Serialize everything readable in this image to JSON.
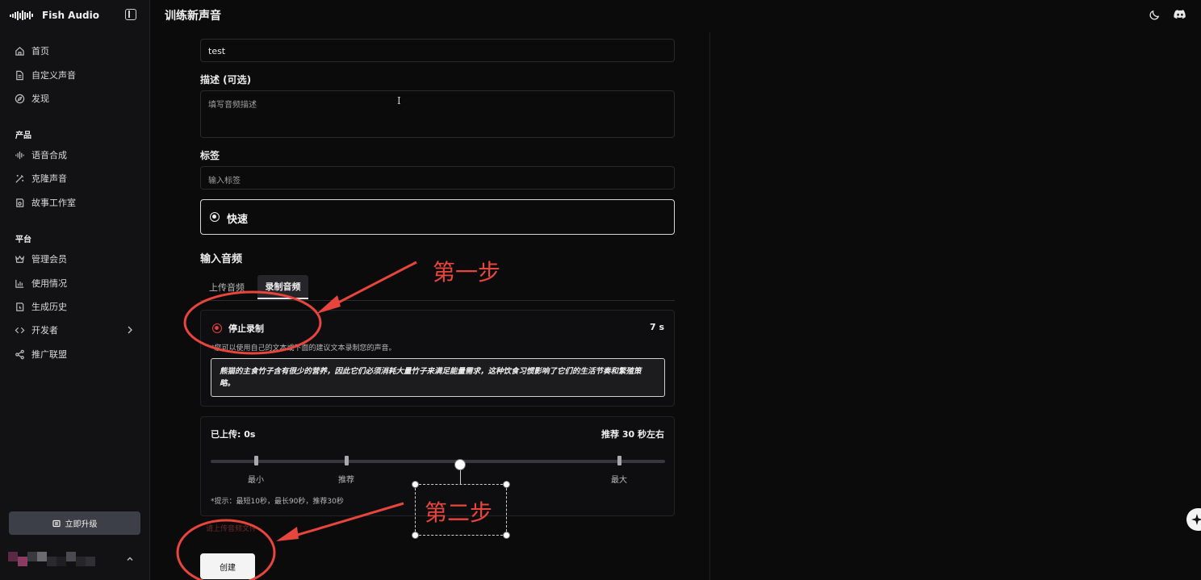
{
  "app": {
    "brand": "Fish Audio",
    "page_title": "训练新声音"
  },
  "sidebar": {
    "main_items": [
      {
        "label": "首页",
        "icon": "home-icon"
      },
      {
        "label": "自定义声音",
        "icon": "file-icon"
      },
      {
        "label": "发现",
        "icon": "compass-icon"
      }
    ],
    "product_section": "产品",
    "product_items": [
      {
        "label": "语音合成",
        "icon": "waveform-icon"
      },
      {
        "label": "克隆声音",
        "icon": "magic-wand-icon"
      },
      {
        "label": "故事工作室",
        "icon": "book-icon"
      }
    ],
    "platform_section": "平台",
    "platform_items": [
      {
        "label": "管理会员",
        "icon": "crown-icon"
      },
      {
        "label": "使用情况",
        "icon": "bar-chart-icon"
      },
      {
        "label": "生成历史",
        "icon": "history-icon"
      },
      {
        "label": "开发者",
        "icon": "code-icon"
      },
      {
        "label": "推广联盟",
        "icon": "share-icon"
      }
    ],
    "upgrade_label": "立即升级"
  },
  "form": {
    "name_value": "test",
    "description_label": "描述 (可选)",
    "description_placeholder": "填写音频描述",
    "tags_label": "标签",
    "tags_placeholder": "输入标签",
    "mode_label": "快速",
    "audio_section_title": "输入音频",
    "tabs": {
      "upload": "上传音频",
      "record": "录制音频"
    },
    "record": {
      "status": "停止录制",
      "elapsed": "7 s",
      "hint": "*您可以使用自己的文本或下面的建议文本录制您的声音。",
      "suggested_text": "熊猫的主食竹子含有很少的营养，因此它们必须消耗大量竹子来满足能量需求，这种饮食习惯影响了它们的生活节奏和繁殖策略。"
    },
    "upload_status": {
      "uploaded": "已上传: 0s",
      "recommend": "推荐 30 秒左右",
      "ticks": {
        "min": "最小",
        "recommend": "推荐",
        "max": "最大"
      },
      "tip": "*提示：最短10秒，最长90秒，推荐30秒"
    },
    "error_text": "请上传音频文件",
    "create_label": "创建"
  },
  "annotations": {
    "step1": "第一步",
    "step2": "第二步",
    "color": "#e8453c"
  }
}
